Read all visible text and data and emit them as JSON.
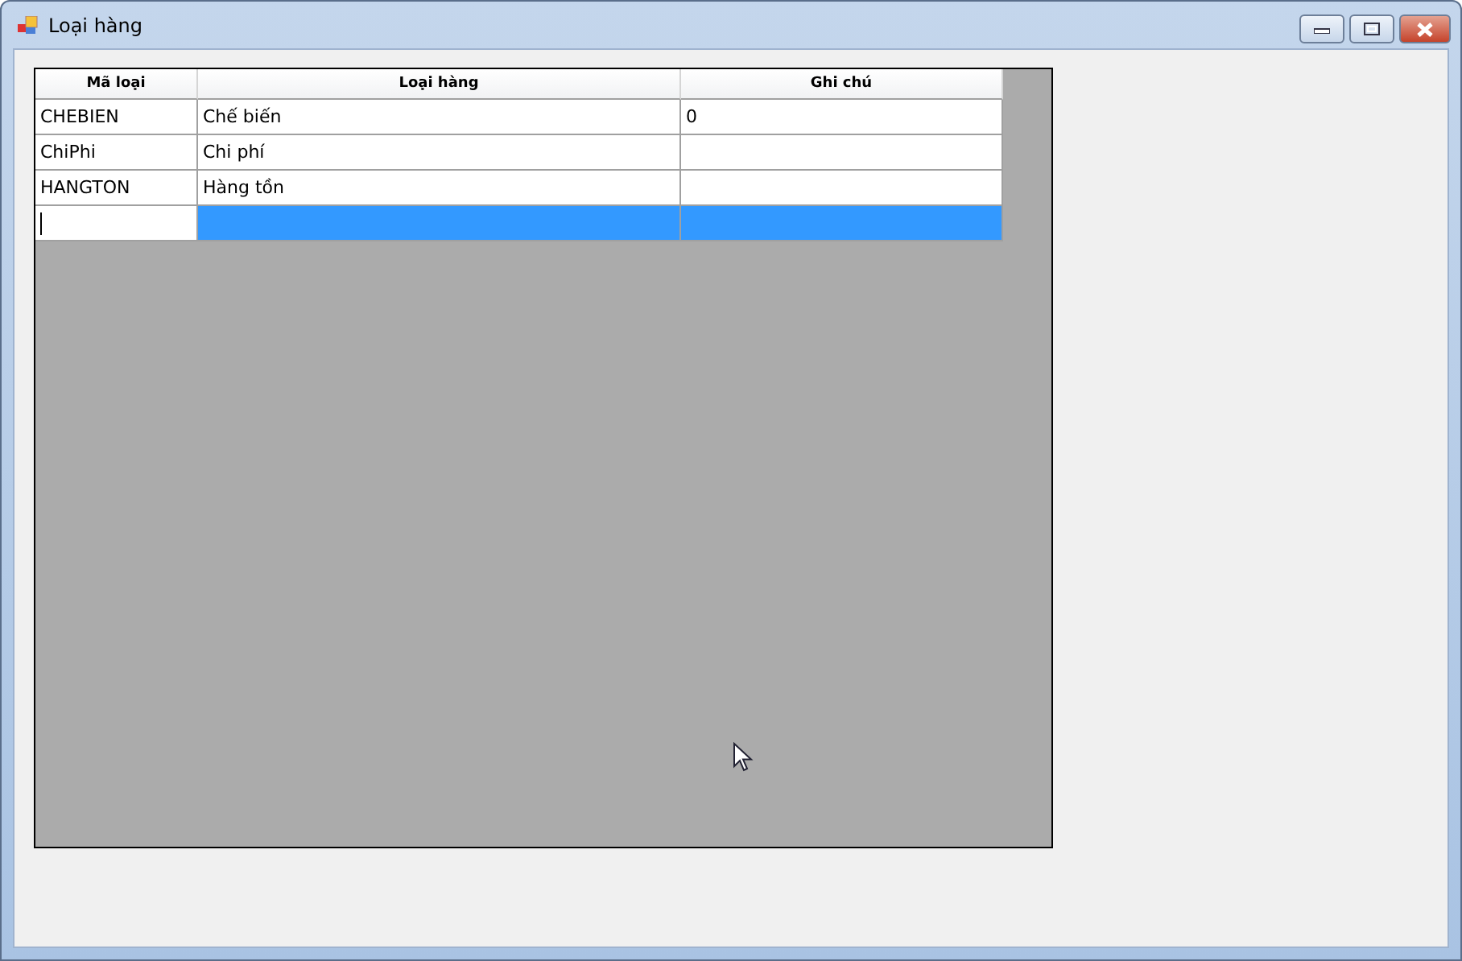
{
  "window": {
    "title": "Loại hàng"
  },
  "table": {
    "columns": [
      "Mã loại",
      "Loại hàng",
      "Ghi chú"
    ],
    "rows": [
      {
        "cells": [
          "CHEBIEN",
          "Chế biến",
          "0"
        ],
        "selected": false
      },
      {
        "cells": [
          "ChiPhi",
          "Chi phí",
          null
        ],
        "selected": false
      },
      {
        "cells": [
          "HANGTON",
          "Hàng tồn",
          null
        ],
        "selected": false
      }
    ],
    "new_row": {
      "selected": true,
      "editing": true
    }
  }
}
